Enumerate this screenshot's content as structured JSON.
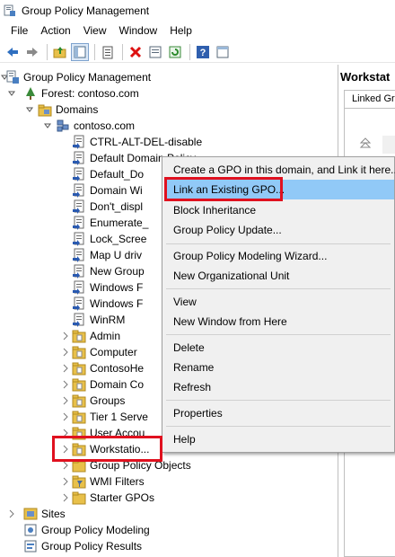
{
  "window": {
    "title": "Group Policy Management"
  },
  "menubar": {
    "items": [
      "File",
      "Action",
      "View",
      "Window",
      "Help"
    ]
  },
  "toolbar": {
    "buttons": [
      "back-arrow-icon",
      "forward-arrow-icon",
      "up-folder-icon",
      "show-hide-tree-icon",
      "properties-icon",
      "delete-icon",
      "export-list-icon",
      "refresh-icon",
      "help-icon",
      "details-view-icon"
    ]
  },
  "tree": {
    "root": "Group Policy Management",
    "forest": "Forest: contoso.com",
    "domains": "Domains",
    "domain": "contoso.com",
    "gpo_links": [
      "CTRL-ALT-DEL-disable",
      "Default Domain Policy",
      "Default_Do",
      "Domain Wi",
      "Don't_displ",
      "Enumerate_",
      "Lock_Scree",
      "Map U driv",
      "New Group",
      "Windows F",
      "Windows F",
      "WinRM"
    ],
    "ous": [
      "Admin",
      "Computer",
      "ContosoHe",
      "Domain Co",
      "Groups",
      "Tier 1 Serve",
      "User Accou",
      "Workstatio..."
    ],
    "containers": [
      "Group Policy Objects",
      "WMI Filters",
      "Starter GPOs"
    ],
    "sites": "Sites",
    "modeling": "Group Policy Modeling",
    "results": "Group Policy Results"
  },
  "right_pane": {
    "header": "Workstat",
    "tab": "Linked Gro"
  },
  "context_menu": {
    "items": [
      "Create a GPO in this domain, and Link it here...",
      "Link an Existing GPO...",
      "Block Inheritance",
      "Group Policy Update...",
      "Group Policy Modeling Wizard...",
      "New Organizational Unit",
      "View",
      "New Window from Here",
      "Delete",
      "Rename",
      "Refresh",
      "Properties",
      "Help"
    ],
    "highlighted": "Link an Existing GPO..."
  },
  "colors": {
    "highlight": "#91c9f7",
    "annotation_red": "#e0111f",
    "folder": "#e8c04a"
  }
}
